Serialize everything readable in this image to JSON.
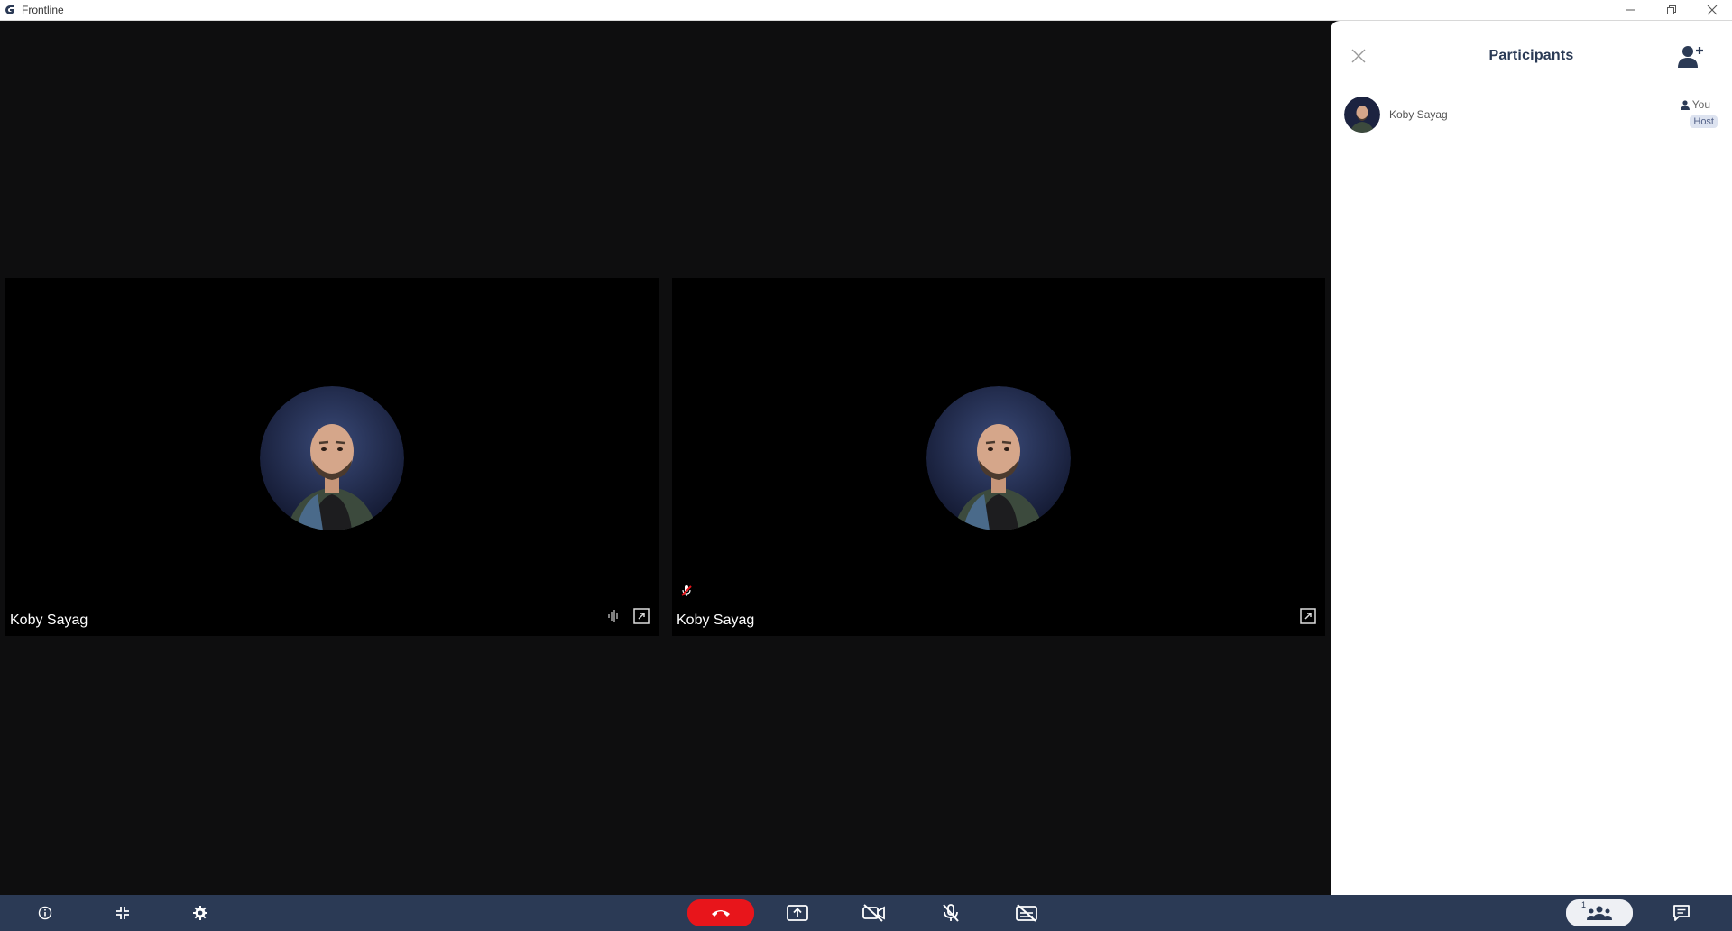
{
  "window": {
    "title": "Frontline"
  },
  "tiles": [
    {
      "name": "Koby Sayag"
    },
    {
      "name": "Koby Sayag"
    }
  ],
  "panel": {
    "title": "Participants",
    "participants": [
      {
        "name": "Koby Sayag",
        "you_label": "You",
        "role": "Host"
      }
    ]
  },
  "toolbar": {
    "participant_count": "1"
  },
  "colors": {
    "toolbar_bg": "#2b3a55",
    "end_call": "#e8151b",
    "panel_title": "#2a3a55"
  },
  "icons": {
    "titlebar": [
      "app-logo",
      "minimize-icon",
      "restore-icon",
      "close-icon"
    ],
    "tile": [
      "audio-wave-icon",
      "expand-icon",
      "mic-muted-icon"
    ],
    "toolbar": [
      "info-icon",
      "collapse-icon",
      "settings-icon",
      "end-call-icon",
      "share-screen-icon",
      "video-off-icon",
      "mic-off-icon",
      "caption-off-icon",
      "participants-icon",
      "chat-icon"
    ]
  }
}
